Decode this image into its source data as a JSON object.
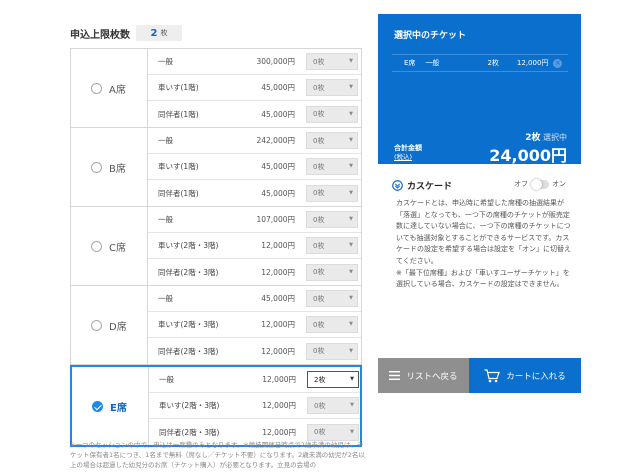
{
  "limit": {
    "label": "申込上限枚数",
    "value": "2",
    "unit": "枚"
  },
  "seat_groups": [
    {
      "name": "A席",
      "selected": false,
      "rows": [
        {
          "type": "一般",
          "price": "300,000円",
          "qty": "0枚"
        },
        {
          "type": "車いす(1階)",
          "price": "45,000円",
          "qty": "0枚"
        },
        {
          "type": "同伴者(1階)",
          "price": "45,000円",
          "qty": "0枚"
        }
      ]
    },
    {
      "name": "B席",
      "selected": false,
      "rows": [
        {
          "type": "一般",
          "price": "242,000円",
          "qty": "0枚"
        },
        {
          "type": "車いす(1階)",
          "price": "45,000円",
          "qty": "0枚"
        },
        {
          "type": "同伴者(1階)",
          "price": "45,000円",
          "qty": "0枚"
        }
      ]
    },
    {
      "name": "C席",
      "selected": false,
      "rows": [
        {
          "type": "一般",
          "price": "107,000円",
          "qty": "0枚"
        },
        {
          "type": "車いす(2階・3階)",
          "price": "12,000円",
          "qty": "0枚"
        },
        {
          "type": "同伴者(2階・3階)",
          "price": "12,000円",
          "qty": "0枚"
        }
      ]
    },
    {
      "name": "D席",
      "selected": false,
      "rows": [
        {
          "type": "一般",
          "price": "45,000円",
          "qty": "0枚"
        },
        {
          "type": "車いす(2階・3階)",
          "price": "12,000円",
          "qty": "0枚"
        },
        {
          "type": "同伴者(2階・3階)",
          "price": "12,000円",
          "qty": "0枚"
        }
      ]
    },
    {
      "name": "E席",
      "selected": true,
      "rows": [
        {
          "type": "一般",
          "price": "12,000円",
          "qty": "2枚",
          "active": true
        },
        {
          "type": "車いす(2階・3階)",
          "price": "12,000円",
          "qty": "0枚"
        },
        {
          "type": "同伴者(2階・3階)",
          "price": "12,000円",
          "qty": "0枚"
        }
      ]
    }
  ],
  "footnote": "※一つのセッションの中で、申込は一席種のみとなります。※競技開催日時点で2歳未満の幼児は、チケット保有者1名につき、1名まで無料（席なし／チケット不要）になります。2歳未満の幼児が2名以上の場合は超過した幼児分のお席（チケット購入）が必要となります。立見の会場の",
  "panel": {
    "title": "選択中のチケット",
    "ticket": {
      "seat": "E席",
      "type": "一般",
      "qty": "2枚",
      "price": "12,000円"
    },
    "count_value": "2枚",
    "count_suffix": "選択中",
    "total_label": "合計金額",
    "total_note": "(税込)",
    "total_value": "24,000円"
  },
  "cascade": {
    "title": "カスケード",
    "off_label": "オフ",
    "on_label": "オン",
    "body1": "カスケードとは、申込時に希望した席種の抽選結果が「落選」となっても、一つ下の席種のチケットが販売定数に達していない場合に、一つ下の席種のチケットについても抽選対象とすることができるサービスです。カスケードの設定を希望する場合は設定を「オン」に切替えてください。",
    "body2": "※「最下位席種」および「車いすユーザーチケット」を選択している場合、カスケードの設定はできません。"
  },
  "buttons": {
    "back": "リストへ戻る",
    "cart": "カートに入れる"
  },
  "colors": {
    "accent": "#0a6fcd",
    "back_button": "#8f8f8f",
    "selected_border": "#1e88e5"
  }
}
